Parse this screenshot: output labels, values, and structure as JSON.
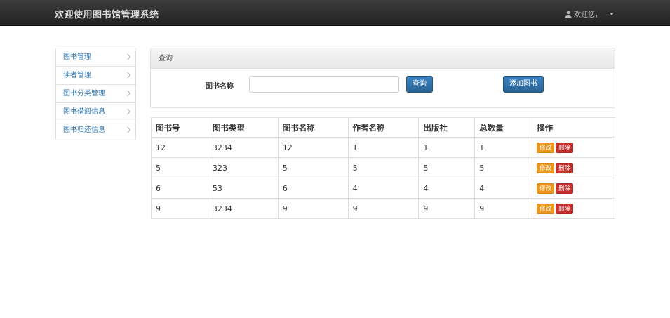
{
  "header": {
    "title": "欢迎使用图书馆管理系统",
    "user_label": "欢迎您，"
  },
  "sidebar": {
    "items": [
      {
        "label": "图书管理"
      },
      {
        "label": "读者管理"
      },
      {
        "label": "图书分类管理"
      },
      {
        "label": "图书借阅信息"
      },
      {
        "label": "图书归还信息"
      }
    ]
  },
  "query_panel": {
    "heading": "查询",
    "field_label": "图书名称",
    "field_value": "",
    "query_button": "查询",
    "add_button": "添加图书"
  },
  "table": {
    "headers": [
      "图书号",
      "图书类型",
      "图书名称",
      "作者名称",
      "出版社",
      "总数量",
      "操作"
    ],
    "rows": [
      [
        "12",
        "3234",
        "12",
        "1",
        "1",
        "1"
      ],
      [
        "5",
        "323",
        "5",
        "5",
        "5",
        "5"
      ],
      [
        "6",
        "53",
        "6",
        "4",
        "4",
        "4"
      ],
      [
        "9",
        "3234",
        "9",
        "9",
        "9",
        "9"
      ]
    ],
    "edit_label": "修改",
    "delete_label": "删除"
  }
}
